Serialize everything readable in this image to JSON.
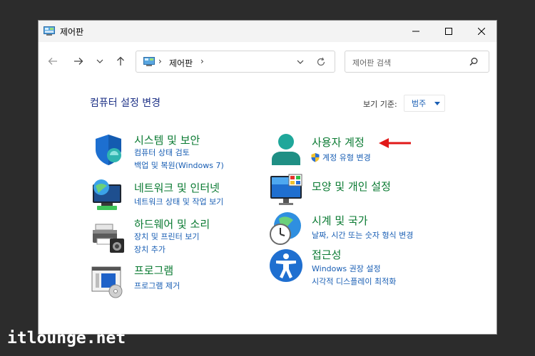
{
  "window": {
    "title": "제어판",
    "buttons": {
      "minimize": "minimize",
      "maximize": "maximize",
      "close": "close"
    }
  },
  "address": {
    "path": "제어판",
    "search_placeholder": "제어판 검색"
  },
  "header": {
    "title": "컴퓨터 설정 변경",
    "view_by_label": "보기 기준:",
    "view_by_value": "범주"
  },
  "categories": [
    {
      "title": "시스템 및 보안",
      "icon": "shield-icon",
      "links": [
        "컴퓨터 상태 검토",
        "백업 및 복원(Windows 7)"
      ]
    },
    {
      "title": "네트워크 및 인터넷",
      "icon": "network-icon",
      "links": [
        "네트워크 상태 및 작업 보기"
      ]
    },
    {
      "title": "하드웨어 및 소리",
      "icon": "printer-icon",
      "links": [
        "장치 및 프린터 보기",
        "장치 추가"
      ]
    },
    {
      "title": "프로그램",
      "icon": "programs-icon",
      "links": [
        "프로그램 제거"
      ]
    },
    {
      "title": "사용자 계정",
      "icon": "user-icon",
      "links": [
        "계정 유형 변경"
      ]
    },
    {
      "title": "모양 및 개인 설정",
      "icon": "monitor-icon",
      "links": []
    },
    {
      "title": "시계 및 국가",
      "icon": "clock-globe-icon",
      "links": [
        "날짜, 시간 또는 숫자 형식 변경"
      ]
    },
    {
      "title": "접근성",
      "icon": "accessibility-icon",
      "links": [
        "Windows 권장 설정",
        "시각적 디스플레이 최적화"
      ]
    }
  ],
  "watermark": "itlounge.net",
  "colors": {
    "category_title": "#0a7a32",
    "link": "#1a5fb4",
    "heading": "#1e3287",
    "annotation_arrow": "#e11919"
  }
}
